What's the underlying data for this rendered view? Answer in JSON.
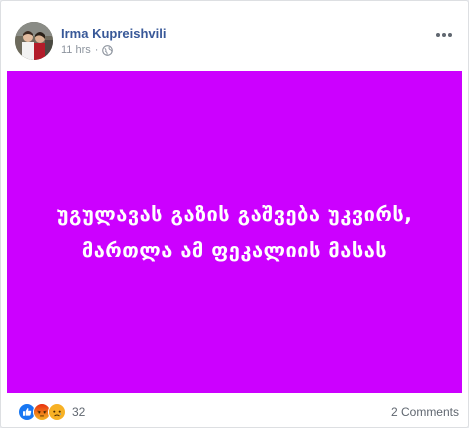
{
  "post": {
    "author": "Irma Kupreishvili",
    "time": "11 hrs",
    "separator": "·",
    "privacy_icon": "globe-icon",
    "menu_icon": "more-options-icon",
    "background_color": "#cc00ff",
    "text": "უგულავას გაზის გაშვება უკვირს, მართლა ამ ფეკალიის მასას"
  },
  "footer": {
    "reaction_icons": [
      "like-icon",
      "angry-icon",
      "sad-icon"
    ],
    "reaction_count": "32",
    "comments_label": "2 Comments"
  },
  "colors": {
    "author_link": "#385898",
    "muted_text": "#8d949e",
    "like_blue": "#1877f2",
    "angry_orange": "#e9710f",
    "sad_yellow": "#f7b125"
  }
}
